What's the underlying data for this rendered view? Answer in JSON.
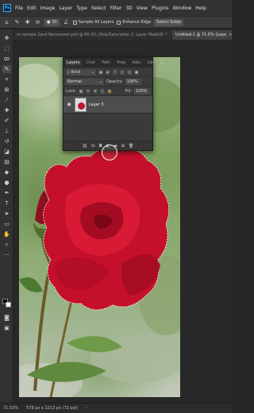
{
  "app": {
    "logo": "Ps"
  },
  "menu": [
    "File",
    "Edit",
    "Image",
    "Layer",
    "Type",
    "Select",
    "Filter",
    "3D",
    "View",
    "Plugins",
    "Window",
    "Help"
  ],
  "options": {
    "brush_size": "30",
    "sample_all_layers": "Sample All Layers",
    "enhance_edge": "Enhance Edge",
    "select_subject": "Select Subje"
  },
  "tabs": {
    "inactive": "ro sample 2psd Recovered.psd @ 66.3% (Hue/Saturation 2, Layer Mask/8) *",
    "active": "Untitled-1 @ 71.5% (Laye"
  },
  "layers_panel": {
    "tabs": [
      "Layers",
      "Char",
      "Path",
      "Prop",
      "Adju",
      "Libs"
    ],
    "active_tab": "Layers",
    "filter_label": "Kind",
    "blend_mode": "Normal",
    "opacity_label": "Opacity:",
    "opacity": "100%",
    "lock_label": "Lock:",
    "fill_label": "Fill:",
    "fill": "100%",
    "layers": [
      {
        "name": "Layer 3",
        "visible": true
      }
    ]
  },
  "status": {
    "zoom": "71.53%",
    "doc_info": "578 px x 1213 px (72 ppi)"
  }
}
